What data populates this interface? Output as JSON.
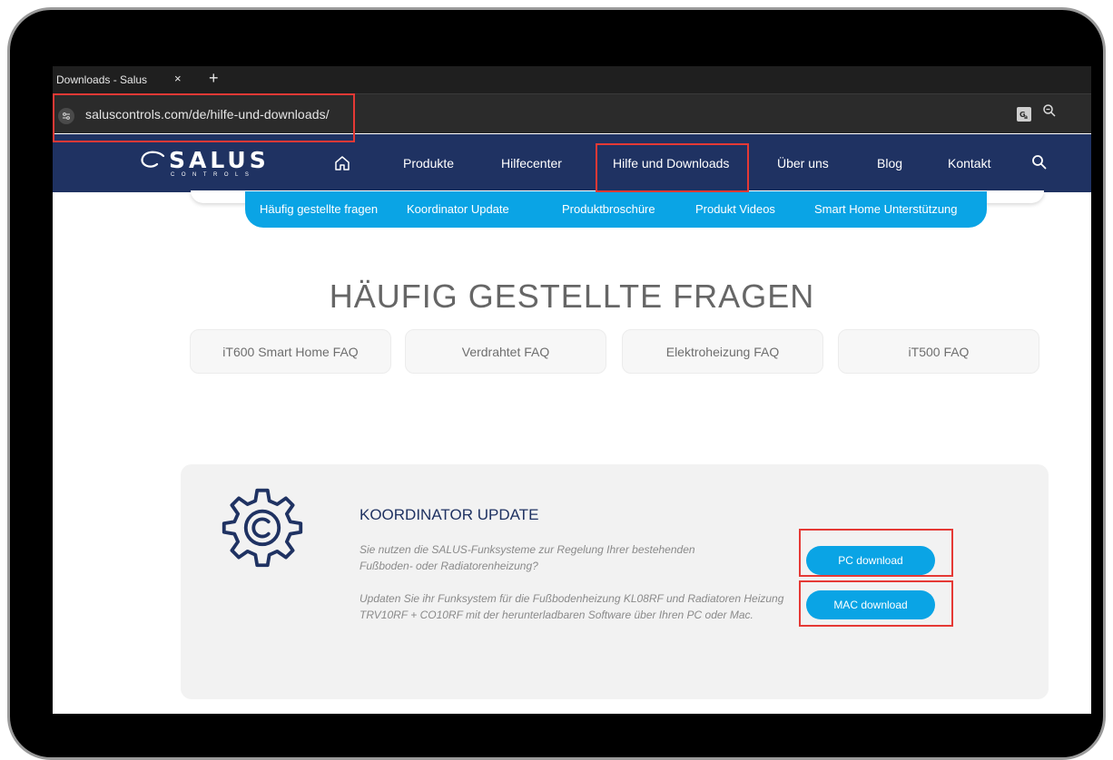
{
  "browser": {
    "tab_title": "Downloads - Salus",
    "tab_close": "×",
    "new_tab": "+",
    "url": "saluscontrols.com/de/hilfe-und-downloads/"
  },
  "site": {
    "logo_text": "SALUS",
    "logo_sub": "CONTROLS",
    "nav": [
      "Produkte",
      "Hilfecenter",
      "Hilfe und Downloads",
      "Über uns",
      "Blog",
      "Kontakt"
    ],
    "subnav": [
      "Häufig gestellte fragen",
      "Koordinator Update",
      "Produktbroschüre",
      "Produkt Videos",
      "Smart Home Unterstützung"
    ],
    "page_title": "HÄUFIG GESTELLTE FRAGEN",
    "faq_buttons": [
      "iT600 Smart Home FAQ",
      "Verdrahtet FAQ",
      "Elektroheizung FAQ",
      "iT500 FAQ"
    ]
  },
  "update": {
    "title": "KOORDINATOR UPDATE",
    "p1": "Sie nutzen die SALUS-Funksysteme zur Regelung Ihrer bestehenden Fußboden- oder Radiatorenheizung?",
    "p2": "Updaten Sie ihr Funksystem für die Fußbodenheizung KL08RF und Radiatoren Heizung TRV10RF + CO10RF mit der herunterladbaren Software über Ihren PC oder Mac.",
    "pc_label": "PC download",
    "mac_label": "MAC download"
  },
  "colors": {
    "nav_bg": "#1f3262",
    "accent": "#0aa4e5",
    "highlight": "#e53935"
  },
  "icons": [
    "site-info-icon",
    "translate-icon",
    "zoom-icon",
    "home-icon",
    "search-icon",
    "gear-icon"
  ]
}
